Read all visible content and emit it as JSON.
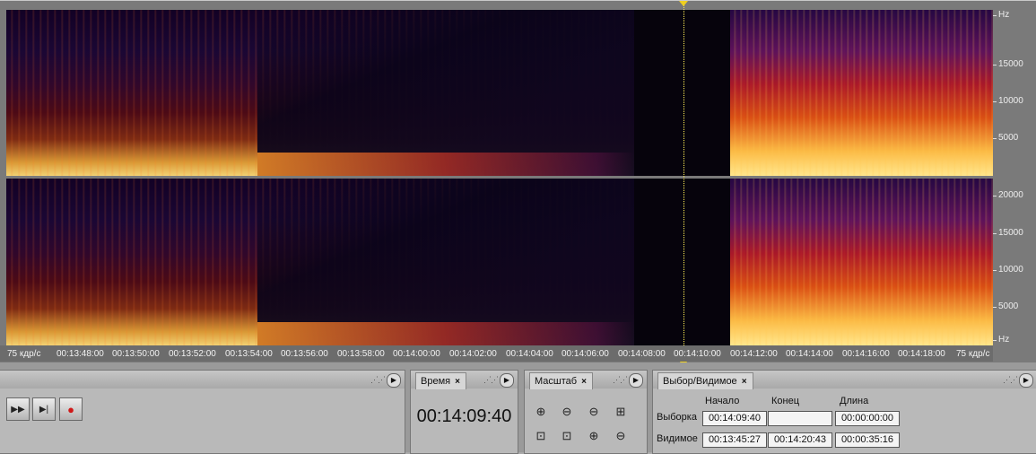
{
  "spectral": {
    "frequency_axis_channel_1": [
      "Hz",
      "15000",
      "10000",
      "5000"
    ],
    "frequency_axis_channel_2": [
      "20000",
      "15000",
      "10000",
      "5000",
      "Hz"
    ],
    "time_ruler": {
      "left_rate": "75 кдр/с",
      "right_rate": "75 кдр/с",
      "ticks": [
        "00:13:48:00",
        "00:13:50:00",
        "00:13:52:00",
        "00:13:54:00",
        "00:13:56:00",
        "00:13:58:00",
        "00:14:00:00",
        "00:14:02:00",
        "00:14:04:00",
        "00:14:06:00",
        "00:14:08:00",
        "00:14:10:00",
        "00:14:12:00",
        "00:14:14:00",
        "00:14:16:00",
        "00:14:18:00"
      ]
    },
    "cursor_color": "#f0d020"
  },
  "transport": {
    "buttons": [
      {
        "name": "fast-forward-button",
        "glyph": "▶▶"
      },
      {
        "name": "go-to-end-button",
        "glyph": "▶|"
      },
      {
        "name": "record-button",
        "glyph": "●"
      }
    ]
  },
  "time_panel": {
    "tab_label": "Время",
    "close_glyph": "×",
    "current_time": "00:14:09:40"
  },
  "zoom_panel": {
    "tab_label": "Масштаб",
    "close_glyph": "×"
  },
  "selection_panel": {
    "tab_label": "Выбор/Видимое",
    "close_glyph": "×",
    "columns": [
      "Начало",
      "Конец",
      "Длина"
    ],
    "rows": [
      {
        "label": "Выборка",
        "start": "00:14:09:40",
        "end": "",
        "length": "00:00:00:00"
      },
      {
        "label": "Видимое",
        "start": "00:13:45:27",
        "end": "00:14:20:43",
        "length": "00:00:35:16"
      }
    ]
  }
}
